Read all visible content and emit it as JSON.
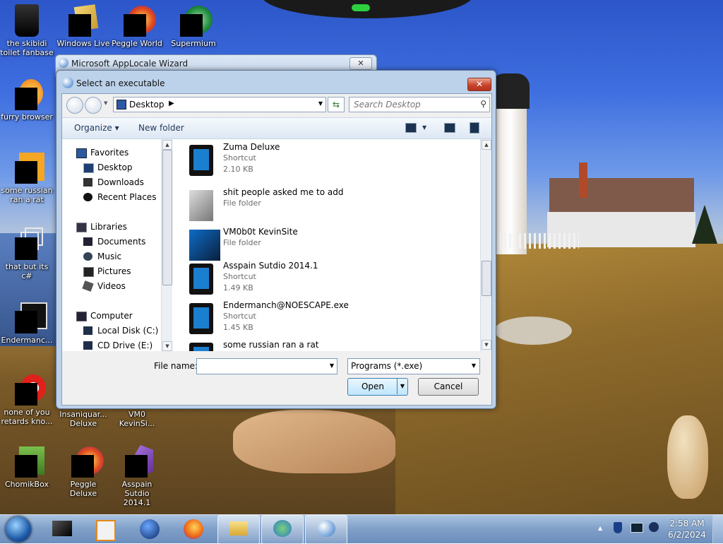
{
  "desktop_icons": [
    {
      "label": "the skibidi toilet  fanbase"
    },
    {
      "label": "Windows Live"
    },
    {
      "label": "Peggle World"
    },
    {
      "label": "Supermium"
    },
    {
      "label": "furry browser"
    },
    {
      "label": "some russian ran a rat"
    },
    {
      "label": "that but its c#"
    },
    {
      "label": "Endermanc..."
    },
    {
      "label": "none of you retards kno..."
    },
    {
      "label": "Insaniquar... Deluxe"
    },
    {
      "label": "VM0 KevinSi..."
    },
    {
      "label": "ChomikBox"
    },
    {
      "label": "Peggle Deluxe"
    },
    {
      "label": "Asspain Sutdio 2014.1"
    }
  ],
  "wizard": {
    "title": "Microsoft AppLocale Wizard",
    "close": "✕"
  },
  "dialog": {
    "title": "Select an executable",
    "close": "✕",
    "address": "Desktop",
    "search_placeholder": "Search Desktop",
    "toolbar": {
      "organize": "Organize ▾",
      "new_folder": "New folder"
    },
    "nav": {
      "favorites": "Favorites",
      "desktop": "Desktop",
      "downloads": "Downloads",
      "recent": "Recent Places",
      "libraries": "Libraries",
      "documents": "Documents",
      "music": "Music",
      "pictures": "Pictures",
      "videos": "Videos",
      "computer": "Computer",
      "local_disk": "Local Disk (C:)",
      "cd_drive": "CD Drive (E:)"
    },
    "files": [
      {
        "name": "Zuma Deluxe",
        "type": "Shortcut",
        "size": "2.10 KB"
      },
      {
        "name": "shit people asked me to add",
        "type": "File folder",
        "size": ""
      },
      {
        "name": "VM0b0t KevinSite",
        "type": "File folder",
        "size": ""
      },
      {
        "name": "Asspain Sutdio 2014.1",
        "type": "Shortcut",
        "size": "1.49 KB"
      },
      {
        "name": "Endermanch@NOESCAPE.exe",
        "type": "Shortcut",
        "size": "1.45 KB"
      },
      {
        "name": "some russian ran a rat",
        "type": "",
        "size": ""
      }
    ],
    "file_name_label": "File name:",
    "file_name_value": "",
    "file_type": "Programs (*.exe)",
    "open": "Open",
    "cancel": "Cancel"
  },
  "taskbar": {
    "time": "2:58 AM",
    "date": "6/2/2024"
  },
  "colors": {
    "accent": "#3c7fb1",
    "title_glass": "#bcd1ea",
    "close_red": "#c8462c"
  }
}
